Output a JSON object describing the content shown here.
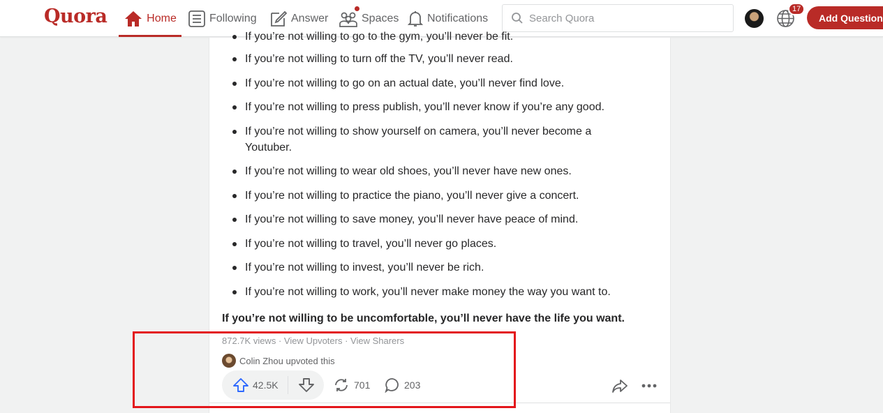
{
  "header": {
    "logo": "Quora",
    "nav": [
      {
        "label": "Home",
        "icon": "home-icon"
      },
      {
        "label": "Following",
        "icon": "following-icon"
      },
      {
        "label": "Answer",
        "icon": "answer-icon"
      },
      {
        "label": "Spaces",
        "icon": "spaces-icon"
      },
      {
        "label": "Notifications",
        "icon": "bell-icon"
      }
    ],
    "search_placeholder": "Search Quora",
    "notification_count": "17",
    "add_question": "Add Question"
  },
  "answer": {
    "bullets": [
      "If you’re not willing to go to the gym, you’ll never be fit.",
      "If you’re not willing to turn off the TV, you’ll never read.",
      "If you’re not willing to go on an actual date, you’ll never find love.",
      "If you’re not willing to press publish, you’ll never know if you’re any good.",
      "If you’re not willing to show yourself on camera, you’ll never become a Youtuber.",
      "If you’re not willing to wear old shoes, you’ll never have new ones.",
      "If you’re not willing to practice the piano, you’ll never give a concert.",
      "If you’re not willing to save money, you’ll never have peace of mind.",
      "If you’re not willing to travel, you’ll never go places.",
      "If you’re not willing to invest, you’ll never be rich.",
      "If you’re not willing to work, you’ll never make money the way you want to."
    ],
    "conclusion": "If you’re not willing to be uncomfortable, you’ll never have the life you want.",
    "views": "872.7K views",
    "separator": " · ",
    "view_upvoters": "View Upvoters",
    "view_sharers": "View Sharers",
    "upvoted_by": "Colin Zhou upvoted this",
    "upvotes": "42.5K",
    "shares": "701",
    "comments": "203"
  },
  "colors": {
    "brand": "#b92b27",
    "upvote_blue": "#2e69ff",
    "annotation_red": "#e3161b"
  }
}
